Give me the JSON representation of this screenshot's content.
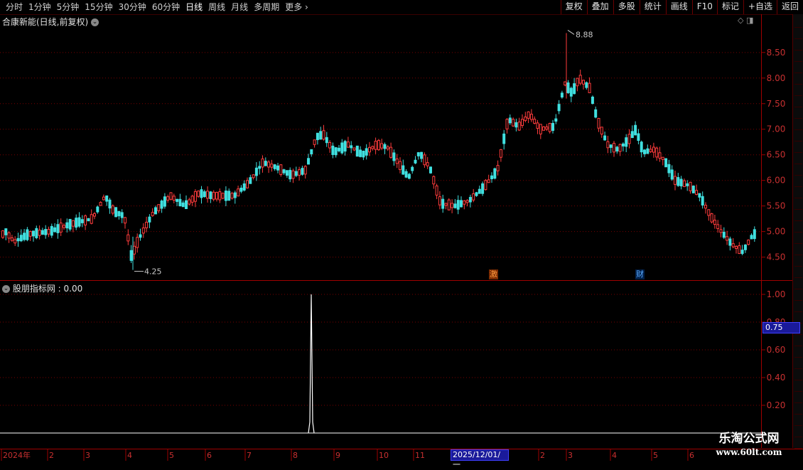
{
  "toolbar": {
    "periods": [
      "分时",
      "1分钟",
      "5分钟",
      "15分钟",
      "30分钟",
      "60分钟",
      "日线",
      "周线",
      "月线",
      "多周期",
      "更多"
    ],
    "active_period": "日线",
    "buttons": [
      "复权",
      "叠加",
      "多股",
      "统计",
      "画线",
      "F10",
      "标记",
      "+自选",
      "返回"
    ]
  },
  "stock": {
    "title": "合康新能(日线,前复权)",
    "high_label": "8.88",
    "low_label": "4.25"
  },
  "price_axis": {
    "ticks": [
      "8.50",
      "8.00",
      "7.50",
      "7.00",
      "6.50",
      "6.00",
      "5.50",
      "5.00",
      "4.50"
    ],
    "values": [
      8.5,
      8.0,
      7.5,
      7.0,
      6.5,
      6.0,
      5.5,
      5.0,
      4.5
    ]
  },
  "indicator": {
    "title": "股朋指标网 : 0.00",
    "ticks": [
      "1.00",
      "0.80",
      "0.60",
      "0.40",
      "0.20"
    ],
    "values": [
      1.0,
      0.8,
      0.6,
      0.4,
      0.2
    ],
    "cursor_value": "0.75"
  },
  "event_tags": [
    {
      "text": "激",
      "color": "#ff9a40",
      "bg": "#7a2a00"
    },
    {
      "text": "财",
      "color": "#5aaaff",
      "bg": "#00204a"
    }
  ],
  "date_axis": {
    "labels": [
      "2024年",
      "2",
      "3",
      "4",
      "5",
      "6",
      "7",
      "8",
      "9",
      "10",
      "11",
      "2",
      "3",
      "4",
      "5",
      "6"
    ],
    "cursor_date": "2025/12/01/一"
  },
  "watermark": {
    "title": "乐淘公式网",
    "url": "www.60lt.com"
  },
  "colors": {
    "up": "#ff3c3c",
    "down": "#40e0e0",
    "grid": "#7a0000",
    "axis_text": "#c83030",
    "frame": "#a00000"
  },
  "chart_data": {
    "type": "candlestick",
    "price_range": [
      4.25,
      8.88
    ],
    "indicator_spike": {
      "value": 1.0,
      "approx_date": "2024-08"
    }
  }
}
